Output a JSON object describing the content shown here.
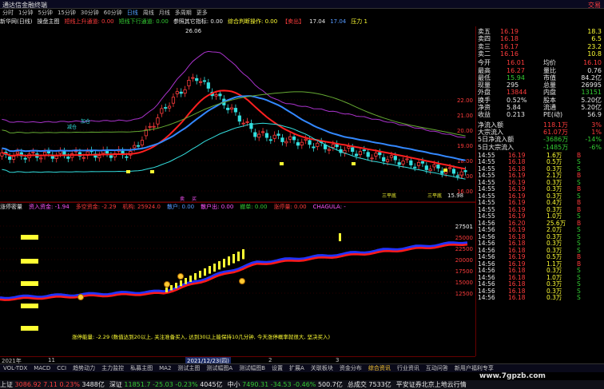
{
  "app": {
    "title": "通达信金融终端",
    "right_label": "交易"
  },
  "toolbar": [
    "分时",
    "1分钟",
    "5分钟",
    "15分钟",
    "30分钟",
    "60分钟",
    "日线",
    "周线",
    "月线",
    "多周期",
    "更多"
  ],
  "toolbar_active": "日线",
  "infobar": [
    {
      "text": "新华网(日线)",
      "color": "#e8e8e8"
    },
    {
      "text": "操盘主图",
      "color": "#e8e8e8"
    },
    {
      "text": "短线上升通道: 0.00",
      "color": "#ff3c3c"
    },
    {
      "text": "短线下行通道: 0.00",
      "color": "#33cc33"
    },
    {
      "text": "参照其它指标: 0.00",
      "color": "#e8e8e8"
    },
    {
      "text": "综合判断操作: 0.00",
      "color": "#ffff33"
    },
    {
      "text": "【卖出】",
      "color": "#ff3c3c"
    },
    {
      "text": "17.04",
      "color": "#e8e8e8"
    },
    {
      "text": "17.04",
      "color": "#5599ff"
    },
    {
      "text": "压力 1",
      "color": "#ffff33"
    }
  ],
  "main_chart": {
    "price_ticks": [
      "22.00",
      "21.00",
      "20.00",
      "19.00",
      "18.00",
      "17.00",
      "16.00"
    ],
    "high_label": "26.06",
    "low_label": "15.98",
    "annotations": [
      "减仓",
      "加仓",
      "三平底",
      "三平底",
      "卖",
      "买"
    ]
  },
  "ind_bar": [
    {
      "text": "涨停密量",
      "color": "#e8e8e8"
    },
    {
      "text": "资入资金: -1.94",
      "color": "#ff55ff"
    },
    {
      "text": "多空资金: -2.29",
      "color": "#ff3c3c"
    },
    {
      "text": "机构: 25924.0",
      "color": "#ff3c3c"
    },
    {
      "text": "散户: 0.00",
      "color": "#5599ff"
    },
    {
      "text": "散户出: 0.00",
      "color": "#ff55ff"
    },
    {
      "text": "撤单: 0.00",
      "color": "#33cc33"
    },
    {
      "text": "涨停量: 0.00",
      "color": "#ff3c3c"
    },
    {
      "text": "CHAGULA: -",
      "color": "#ff55ff"
    }
  ],
  "sub_chart": {
    "ticks": [
      "27501",
      "25000",
      "22500",
      "20000",
      "17500",
      "15000",
      "12500"
    ],
    "note": "涨停能量: -2.29 (数值达到20以上, 关注准备买入, 达到30以上能保持10几分钟, 今天涨停概率就很大, 坚决买入)"
  },
  "timebar": {
    "left": "2021年",
    "mid1": "11",
    "center": "2021/12/23(四)",
    "mid2": "2",
    "right": "3"
  },
  "quote": {
    "orderbook": [
      {
        "label": "卖五",
        "price": "16.19",
        "vol": "18.3"
      },
      {
        "label": "卖四",
        "price": "16.18",
        "vol": "6.5"
      },
      {
        "label": "卖三",
        "price": "16.17",
        "vol": "23.2"
      },
      {
        "label": "卖二",
        "price": "16.16",
        "vol": "10.8"
      }
    ],
    "stats": [
      {
        "l1": "今开",
        "v1": "16.01",
        "l2": "均价",
        "v2": "16.10",
        "c1": "#ff3c3c",
        "c2": "#ff3c3c"
      },
      {
        "l1": "最高",
        "v1": "16.27",
        "l2": "量比",
        "v2": "0.76",
        "c1": "#ff3c3c",
        "c2": "#e8e8e8"
      },
      {
        "l1": "最低",
        "v1": "15.94",
        "l2": "市值",
        "v2": "84.2亿",
        "c1": "#33cc33",
        "c2": "#e8e8e8"
      },
      {
        "l1": "现量",
        "v1": "295",
        "l2": "总量",
        "v2": "26995",
        "c1": "#e8e8e8",
        "c2": "#e8e8e8"
      },
      {
        "l1": "外盘",
        "v1": "13844",
        "l2": "内盘",
        "v2": "13151",
        "c1": "#ff3c3c",
        "c2": "#33cc33"
      },
      {
        "l1": "换手",
        "v1": "0.52%",
        "l2": "股本",
        "v2": "5.20亿",
        "c1": "#e8e8e8",
        "c2": "#e8e8e8"
      },
      {
        "l1": "净资",
        "v1": "5.84",
        "l2": "流通",
        "v2": "5.20亿",
        "c1": "#e8e8e8",
        "c2": "#e8e8e8"
      },
      {
        "l1": "收益",
        "v1": "0.213",
        "l2": "PE(动)",
        "v2": "56.9",
        "c1": "#e8e8e8",
        "c2": "#e8e8e8"
      }
    ],
    "flows": [
      {
        "label": "净流入额",
        "value": "118.1万",
        "pct": "3%",
        "color": "#ff3c3c"
      },
      {
        "label": "大宗流入",
        "value": "61.07万",
        "pct": "1%",
        "color": "#ff3c3c"
      },
      {
        "label": "5日净流入额",
        "value": "-3686万",
        "pct": "-14%",
        "color": "#33cc33"
      },
      {
        "label": "5日大宗流入",
        "value": "-1485万",
        "pct": "-6%",
        "color": "#33cc33"
      }
    ],
    "ticks": [
      {
        "t": "14:55",
        "p": "16.19",
        "v": "1.6万",
        "d": "B"
      },
      {
        "t": "14:55",
        "p": "16.18",
        "v": "0.5万",
        "d": "S"
      },
      {
        "t": "14:55",
        "p": "16.18",
        "v": "0.3万",
        "d": "S"
      },
      {
        "t": "14:55",
        "p": "16.19",
        "v": "2.1万",
        "d": "B"
      },
      {
        "t": "14:55",
        "p": "16.19",
        "v": "0.3万",
        "d": "S"
      },
      {
        "t": "14:55",
        "p": "16.19",
        "v": "0.3万",
        "d": "B"
      },
      {
        "t": "14:55",
        "p": "16.19",
        "v": "0.3万",
        "d": "S"
      },
      {
        "t": "14:55",
        "p": "16.19",
        "v": "0.4万",
        "d": "B"
      },
      {
        "t": "14:55",
        "p": "16.19",
        "v": "0.3万",
        "d": "B"
      },
      {
        "t": "14:55",
        "p": "16.19",
        "v": "1.0万",
        "d": "S"
      },
      {
        "t": "14:56",
        "p": "16.20",
        "v": "25.6万",
        "d": "B"
      },
      {
        "t": "14:56",
        "p": "16.19",
        "v": "2.0万",
        "d": "S"
      },
      {
        "t": "14:56",
        "p": "16.18",
        "v": "0.3万",
        "d": "S"
      },
      {
        "t": "14:56",
        "p": "16.18",
        "v": "0.3万",
        "d": "S"
      },
      {
        "t": "14:56",
        "p": "16.18",
        "v": "0.3万",
        "d": "S"
      },
      {
        "t": "14:56",
        "p": "16.19",
        "v": "0.5万",
        "d": "B"
      },
      {
        "t": "14:56",
        "p": "16.19",
        "v": "1.1万",
        "d": "B"
      },
      {
        "t": "14:56",
        "p": "16.18",
        "v": "0.3万",
        "d": "S"
      },
      {
        "t": "14:56",
        "p": "16.18",
        "v": "1.0万",
        "d": "S"
      },
      {
        "t": "14:56",
        "p": "16.18",
        "v": "0.3万",
        "d": "S"
      },
      {
        "t": "14:56",
        "p": "16.18",
        "v": "0.3万",
        "d": "S"
      },
      {
        "t": "14:56",
        "p": "16.18",
        "v": "0.3万",
        "d": "S"
      }
    ]
  },
  "tabs": [
    "扩展A",
    "关联板块",
    "资金分布",
    "综合资讯",
    "行业资讯",
    "互动问答",
    "新用户福利专享"
  ],
  "indicator_tabs": [
    "VOL-TDX",
    "MACD",
    "CCI",
    "趋势动力",
    "主力监控",
    "私募主图",
    "MA2",
    "测试主图",
    "测试幅图A",
    "测试幅图B",
    "设置"
  ],
  "statusbar": [
    {
      "name": "上证",
      "val": "3086.92",
      "chg": "7.11",
      "pct": "0.23%",
      "amt": "3488亿",
      "color": "#ff3c3c"
    },
    {
      "name": "深证",
      "val": "11851.7",
      "chg": "-25.03",
      "pct": "-0.23%",
      "amt": "4045亿",
      "color": "#33cc33"
    },
    {
      "name": "中小",
      "val": "7490.31",
      "chg": "-34.53",
      "pct": "-0.46%",
      "amt": "500.7亿",
      "color": "#33cc33"
    },
    {
      "name": "总成交",
      "val": "7533亿",
      "chg": "",
      "pct": "",
      "amt": "",
      "color": "#e8e8e8"
    }
  ],
  "status_right": "平安证券北京上地云行情",
  "watermark": "www.7gpzb.com"
}
